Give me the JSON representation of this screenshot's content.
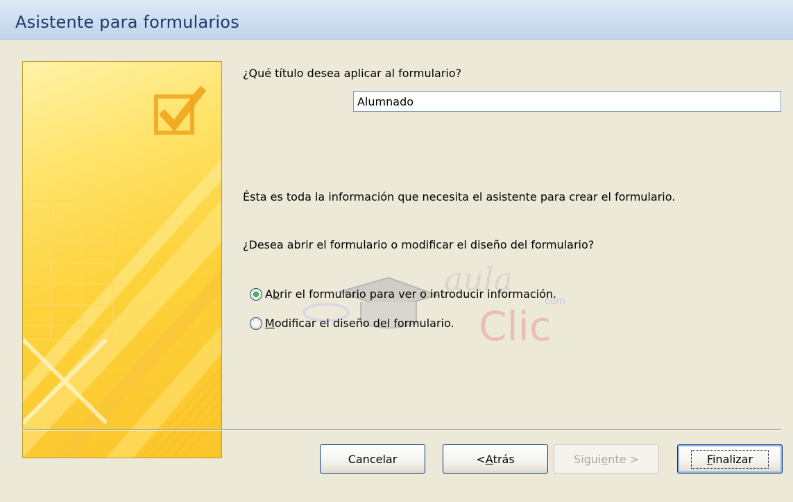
{
  "window": {
    "title": "Asistente para formularios"
  },
  "question_title": "¿Qué título desea aplicar al formulario?",
  "title_input": {
    "value": "Alumnado"
  },
  "info_text": "Ésta es toda la información que necesita el asistente para crear el formulario.",
  "open_question": "¿Desea abrir el formulario o modificar el diseño del formulario?",
  "options": [
    {
      "label": "Abrir el formulario para ver o introducir información.",
      "mnemonic": "b",
      "checked": true
    },
    {
      "label": "Modificar el diseño del formulario.",
      "mnemonic": "M",
      "checked": false
    }
  ],
  "watermark": {
    "brand": "aula Clic",
    "suffix": "com"
  },
  "buttons": {
    "cancel": "Cancelar",
    "back": "< Atrás",
    "next": "Siguiente >",
    "finish": "Finalizar"
  },
  "colors": {
    "title_bar": "#cbdcf0",
    "side_panel": "#fdd23a",
    "accent_check": "#f0a41c"
  },
  "icons": {
    "side_panel": "checkbox-check-icon"
  }
}
